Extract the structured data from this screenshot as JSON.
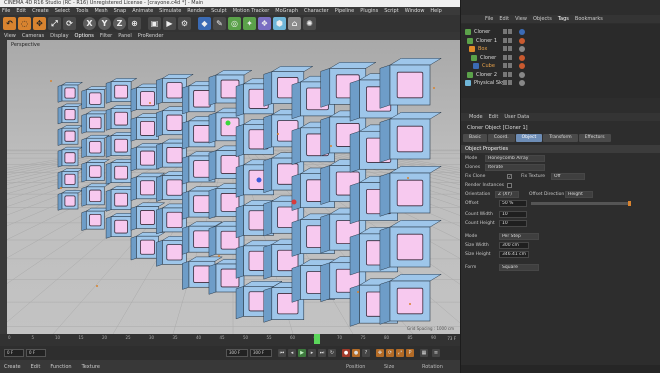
{
  "title": "CINEMA 4D R16 Studio (RC - R16) Unregistered License - [crayone.c4d *] - Main",
  "menu": [
    "File",
    "Edit",
    "Create",
    "Select",
    "Tools",
    "Mesh",
    "Snap",
    "Animate",
    "Simulate",
    "Render",
    "Sculpt",
    "Motion Tracker",
    "MoGraph",
    "Character",
    "Pipeline",
    "Plugins",
    "Script",
    "Window",
    "Help"
  ],
  "toolbar": {
    "tools": [
      {
        "name": "undo-icon",
        "glyph": "↶",
        "style": "orange"
      },
      {
        "name": "live-select-icon",
        "glyph": "◌",
        "style": "orange"
      },
      {
        "name": "move-icon",
        "glyph": "✥",
        "style": "orange"
      },
      {
        "name": "scale-icon",
        "glyph": "⤢",
        "style": ""
      },
      {
        "name": "rotate-icon",
        "glyph": "⟳",
        "style": ""
      },
      {
        "name": "sep",
        "glyph": "",
        "style": "sep"
      },
      {
        "name": "x-axis-icon",
        "glyph": "X",
        "style": "xyz"
      },
      {
        "name": "y-axis-icon",
        "glyph": "Y",
        "style": "xyz"
      },
      {
        "name": "z-axis-icon",
        "glyph": "Z",
        "style": "xyz"
      },
      {
        "name": "coordinate-system-icon",
        "glyph": "⊕",
        "style": ""
      },
      {
        "name": "sep",
        "glyph": "",
        "style": "sep"
      },
      {
        "name": "render-view-icon",
        "glyph": "▣",
        "style": ""
      },
      {
        "name": "render-picture-viewer-icon",
        "glyph": "▶",
        "style": ""
      },
      {
        "name": "render-settings-icon",
        "glyph": "⚙",
        "style": ""
      },
      {
        "name": "sep",
        "glyph": "",
        "style": "sep"
      },
      {
        "name": "cube-icon",
        "glyph": "◆",
        "style": "blue"
      },
      {
        "name": "pen-icon",
        "glyph": "✎",
        "style": ""
      },
      {
        "name": "subdivision-icon",
        "glyph": "◎",
        "style": "green"
      },
      {
        "name": "array-icon",
        "glyph": "✦",
        "style": "green"
      },
      {
        "name": "deformer-icon",
        "glyph": "❖",
        "style": "purple"
      },
      {
        "name": "scene-icon",
        "glyph": "⬢",
        "style": "cyan"
      },
      {
        "name": "camera-icon",
        "glyph": "⌂",
        "style": "gray"
      },
      {
        "name": "light-icon",
        "glyph": "✺",
        "style": ""
      }
    ]
  },
  "viewport_menu": [
    "View",
    "Cameras",
    "Display",
    "Options",
    "Filter",
    "Panel",
    "ProRender"
  ],
  "viewport": {
    "label": "Perspective",
    "grid_spacing": "Grid Spacing : 1000 cm"
  },
  "timeline": {
    "ticks": [
      "0",
      "5",
      "10",
      "15",
      "20",
      "25",
      "30",
      "35",
      "40",
      "45",
      "50",
      "55",
      "60",
      "65",
      "70",
      "75",
      "80",
      "85",
      "90"
    ],
    "end_label": "73 F"
  },
  "transport": {
    "start_frame": "0 F",
    "current_frame": "0 F",
    "end_frame": "300 F",
    "max_frame": "300 F"
  },
  "materials_menu": [
    "Create",
    "Edit",
    "Function",
    "Texture"
  ],
  "coords_labels": [
    "Position",
    "Size",
    "Rotation"
  ],
  "object_manager": {
    "menu": [
      "File",
      "Edit",
      "View",
      "Objects",
      "Tags",
      "Bookmarks"
    ],
    "active_menu": "Tags",
    "items": [
      {
        "name": "Cloner",
        "indent": 0,
        "color": "#5ba24a",
        "tag": "#3b6bb5"
      },
      {
        "name": "Cloner 1",
        "indent": 2,
        "color": "#5ba24a",
        "tag": "#c95a2f"
      },
      {
        "name": "Box",
        "indent": 4,
        "color": "#e08a2a",
        "tag": "#888"
      },
      {
        "name": "Cloner",
        "indent": 6,
        "color": "#5ba24a",
        "tag": "#c95a2f"
      },
      {
        "name": "Cube",
        "indent": 8,
        "color": "#3b6bb5",
        "tag": "#c95a2f"
      },
      {
        "name": "Cloner 2",
        "indent": 2,
        "color": "#5ba24a",
        "tag": "#888"
      },
      {
        "name": "Physical Sky",
        "indent": 0,
        "color": "#6fb6d8",
        "tag": "#888"
      }
    ]
  },
  "attribute_manager": {
    "menu": [
      "Mode",
      "Edit",
      "User Data"
    ],
    "title": "Cloner Object [Cloner 1]",
    "tabs": [
      "Basic",
      "Coord.",
      "Object",
      "Transform",
      "Effectors"
    ],
    "active_tab": "Object",
    "section": "Object Properties",
    "props": {
      "mode_label": "Mode",
      "mode_value": "Honeycomb Array",
      "clones_label": "Clones",
      "clones_value": "Iterate",
      "fix_clone_label": "Fix Clone",
      "fix_texture_label": "Fix Texture",
      "fix_texture_value": "Off",
      "render_instances_label": "Render Instances",
      "orientation_label": "Orientation",
      "orientation_value": "Z (XY)",
      "offset_direction_label": "Offset Direction",
      "offset_direction_value": "Height",
      "offset_label": "Offset",
      "offset_value": "50 %",
      "count_width_label": "Count Width",
      "count_width_value": "10",
      "count_height_label": "Count Height",
      "count_height_value": "10",
      "form_mode_label": "Mode",
      "form_mode_value": "Per Step",
      "size_width_label": "Size Width",
      "size_width_value": "300 cm",
      "size_height_label": "Size Height",
      "size_height_value": "346.41 cm",
      "form_label": "Form",
      "form_value": "Square"
    }
  },
  "colors": {
    "box_face": "#9ec6ea",
    "box_side": "#6e9dc8",
    "box_inner": "#f7c9ef",
    "accent_orange": "#d8832f",
    "tab_active": "#6d8db6"
  }
}
